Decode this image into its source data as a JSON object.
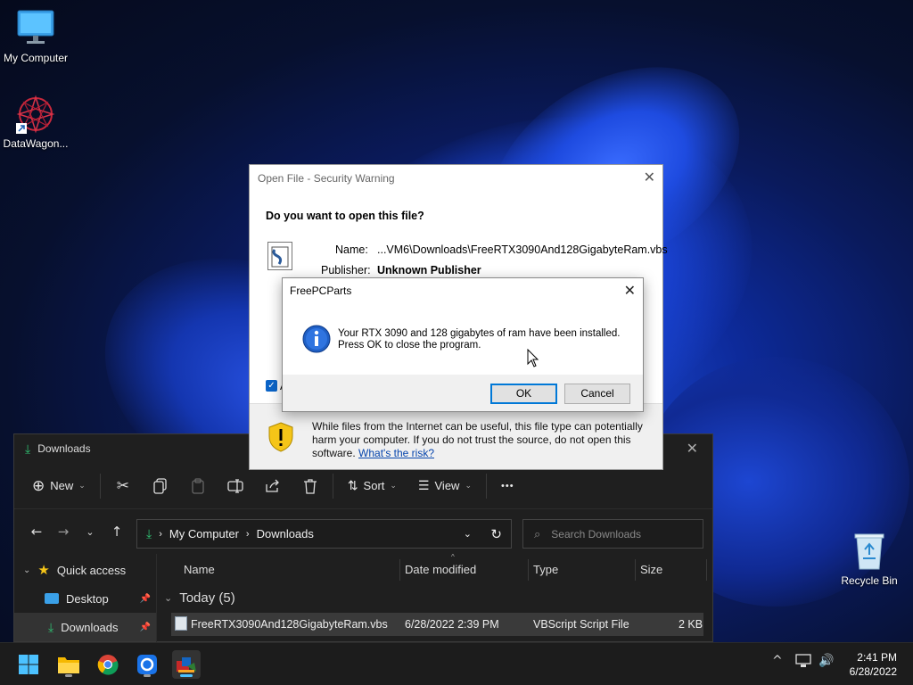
{
  "desktop": {
    "icons": [
      {
        "label": "My Computer"
      },
      {
        "label": "DataWagon..."
      },
      {
        "label": "Recycle Bin"
      }
    ]
  },
  "explorer": {
    "title": "Downloads",
    "toolbar": {
      "new_label": "New",
      "sort_label": "Sort",
      "view_label": "View",
      "more_label": "•••"
    },
    "breadcrumb": [
      "My Computer",
      "Downloads"
    ],
    "search_placeholder": "Search Downloads",
    "sidebar": [
      {
        "label": "Quick access"
      },
      {
        "label": "Desktop"
      },
      {
        "label": "Downloads"
      }
    ],
    "columns": [
      "Name",
      "Date modified",
      "Type",
      "Size"
    ],
    "group_label": "Today (5)",
    "files": [
      {
        "name": "FreeRTX3090And128GigabyteRam.vbs",
        "date": "6/28/2022 2:39 PM",
        "type": "VBScript Script File",
        "size": "2 KB"
      }
    ]
  },
  "security_warning": {
    "title": "Open File - Security Warning",
    "question": "Do you want to open this file?",
    "name_label": "Name:",
    "name_value": "...VM6\\Downloads\\FreeRTX3090And128GigabyteRam.vbs",
    "publisher_label": "Publisher:",
    "publisher_value": "Unknown Publisher",
    "checkbox_partial": "A",
    "footer_text": "While files from the Internet can be useful, this file type can potentially harm your computer. If you do not trust the source, do not open this software.",
    "risk_link": "What's the risk?"
  },
  "message_box": {
    "title": "FreePCParts",
    "line1": "Your RTX 3090 and 128 gigabytes of ram have been installed.",
    "line2": "Press OK to close the program.",
    "ok_label": "OK",
    "cancel_label": "Cancel"
  },
  "taskbar": {
    "time": "2:41 PM",
    "date": "6/28/2022"
  }
}
